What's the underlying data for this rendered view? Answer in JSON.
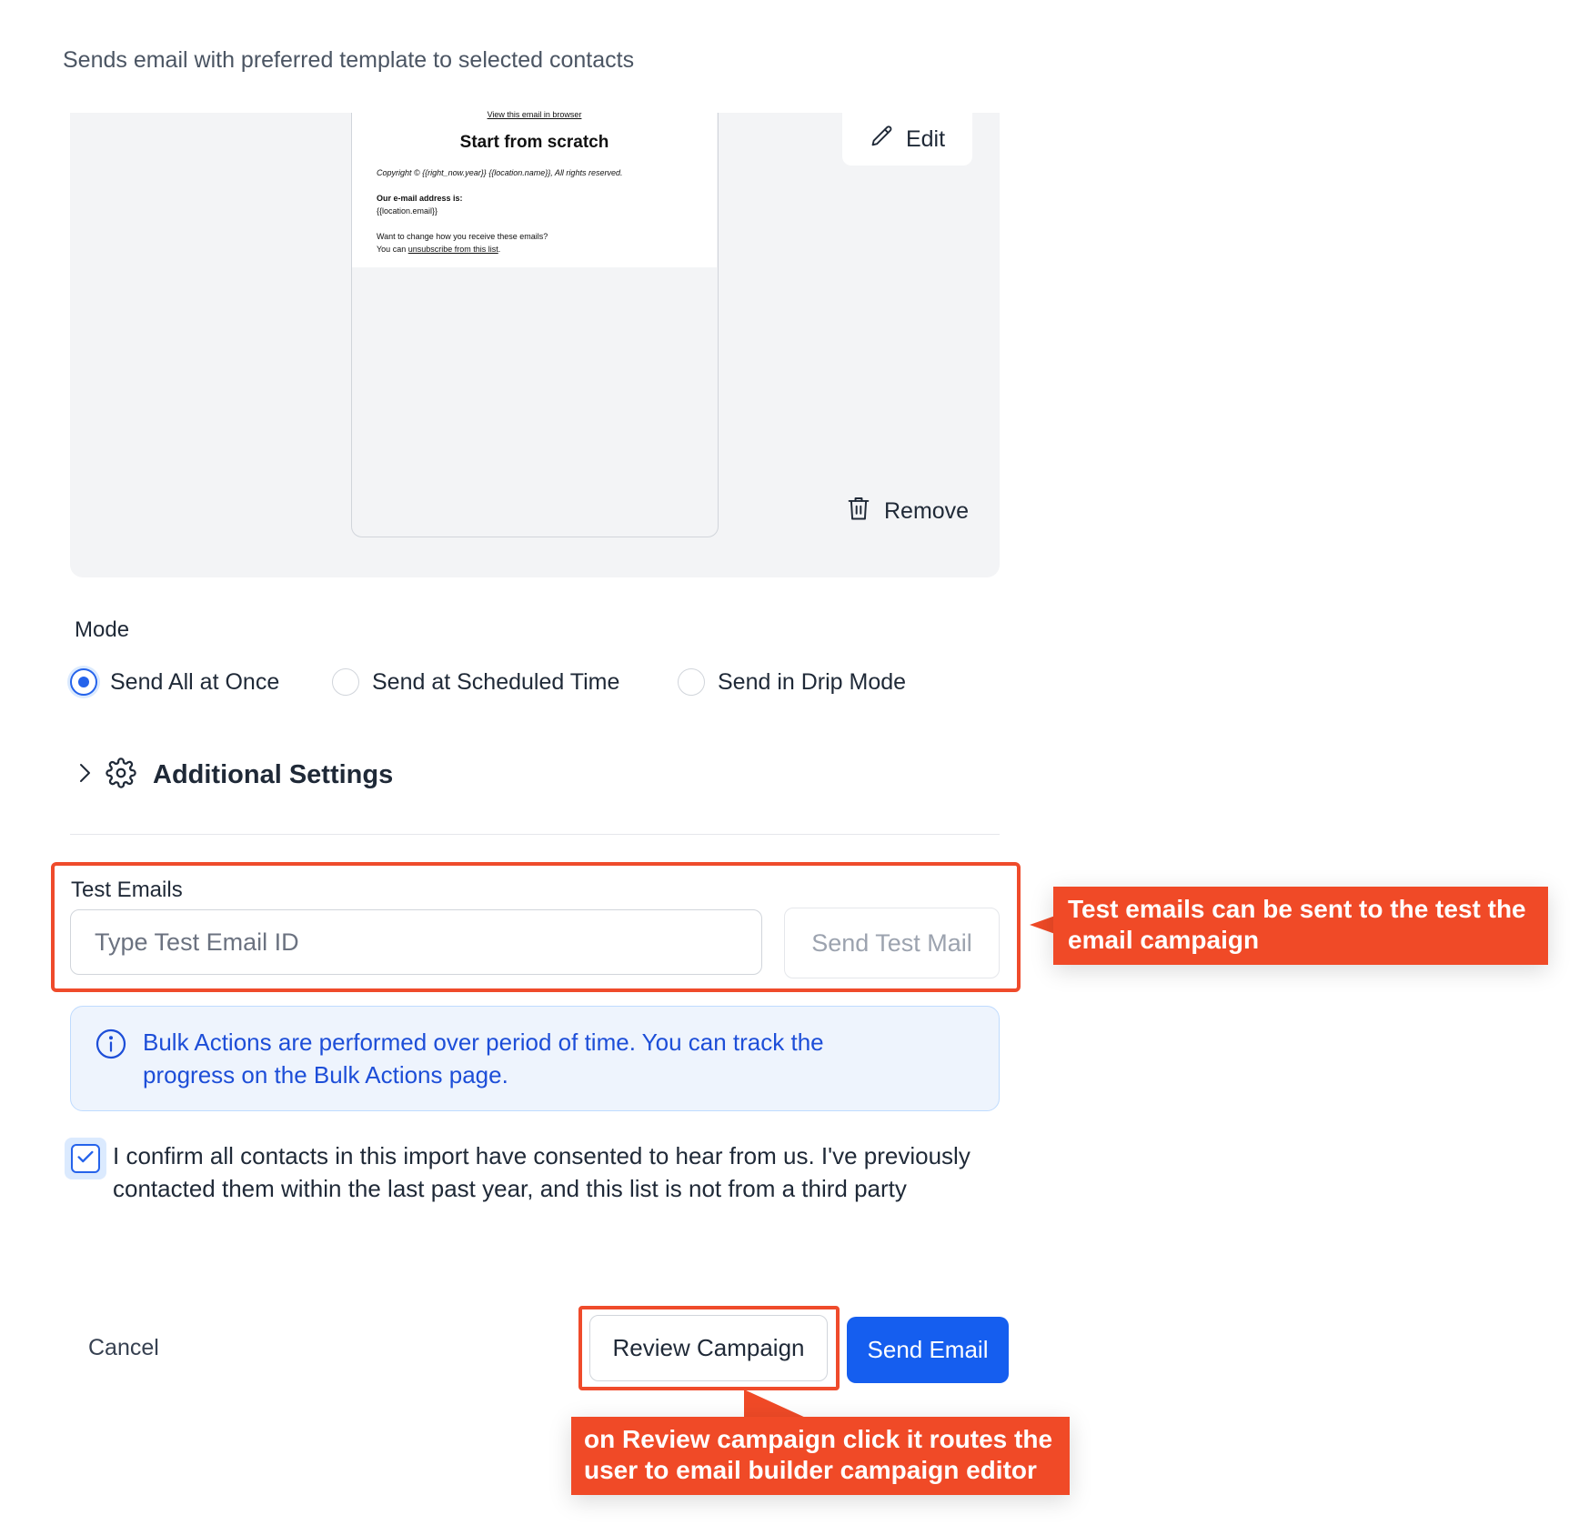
{
  "header": {
    "subtitle": "Sends email with preferred template to selected contacts"
  },
  "template_preview": {
    "view_link": "View this email in browser",
    "title": "Start from scratch",
    "copyright": "Copyright © {{right_now.year}}  {{location.name}}, All rights reserved.",
    "address_label": "Our e-mail address is:",
    "address_value": "{{location.email}}",
    "change_text": "Want to change how you receive these emails?",
    "unsub_prefix": "You can ",
    "unsub_link": "unsubscribe from this list",
    "unsub_suffix": ".",
    "edit_label": "Edit",
    "remove_label": "Remove"
  },
  "mode": {
    "label": "Mode",
    "options": [
      {
        "label": "Send All at Once",
        "selected": true
      },
      {
        "label": "Send at Scheduled Time",
        "selected": false
      },
      {
        "label": "Send in Drip Mode",
        "selected": false
      }
    ]
  },
  "additional_settings": {
    "label": "Additional Settings"
  },
  "test_emails": {
    "label": "Test Emails",
    "input_placeholder": "Type Test Email ID",
    "input_value": "",
    "send_label": "Send Test Mail"
  },
  "info": {
    "text": "Bulk Actions are performed over period of time. You can track the progress on the Bulk Actions page."
  },
  "consent": {
    "checked": true,
    "text": "I confirm all contacts in this import have consented to hear from us. I've previously contacted them within the last past year, and this list is not from a third party"
  },
  "footer": {
    "cancel_label": "Cancel",
    "review_label": "Review Campaign",
    "send_label": "Send Email"
  },
  "annotations": {
    "test_emails_note": "Test emails can be sent to the test the email campaign",
    "review_note": "on Review campaign click it routes the user to email builder campaign editor"
  },
  "colors": {
    "primary": "#155eef",
    "annotation": "#f04a27",
    "info_bg": "#eef4fd",
    "info_text": "#1d4ed8"
  }
}
